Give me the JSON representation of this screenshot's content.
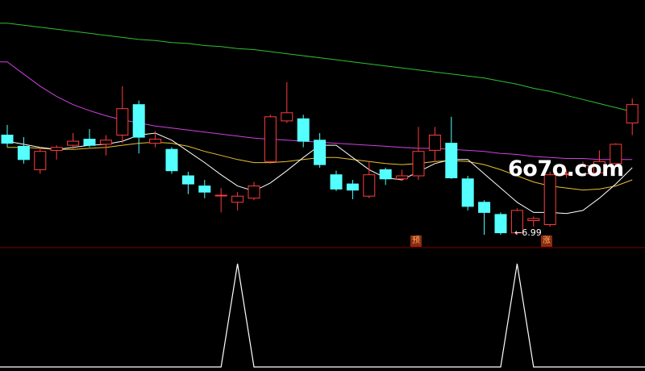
{
  "watermark": "6o7o.com",
  "low_label": "←6.99",
  "markers": {
    "pre": "预",
    "rise": "涨"
  },
  "colors": {
    "background": "#000000",
    "up": "#ff3c3c",
    "down": "#54ffff",
    "ma_short": "#ffffff",
    "ma_mid": "#e8c030",
    "ma_long": "#d040e0",
    "ma_longest": "#30c030",
    "divider": "#800000",
    "signal": "#ffffff"
  },
  "chart_data": [
    {
      "type": "candlestick",
      "series_name": "price",
      "candles": [
        {
          "o": 7.82,
          "c": 7.74,
          "h": 7.92,
          "l": 7.7
        },
        {
          "o": 7.71,
          "c": 7.58,
          "h": 7.8,
          "l": 7.54
        },
        {
          "o": 7.48,
          "c": 7.66,
          "h": 7.7,
          "l": 7.44
        },
        {
          "o": 7.67,
          "c": 7.7,
          "h": 7.72,
          "l": 7.58
        },
        {
          "o": 7.72,
          "c": 7.76,
          "h": 7.84,
          "l": 7.68
        },
        {
          "o": 7.78,
          "c": 7.72,
          "h": 7.88,
          "l": 7.7
        },
        {
          "o": 7.73,
          "c": 7.77,
          "h": 7.82,
          "l": 7.62
        },
        {
          "o": 7.82,
          "c": 8.08,
          "h": 8.3,
          "l": 7.74
        },
        {
          "o": 8.12,
          "c": 7.8,
          "h": 8.16,
          "l": 7.64
        },
        {
          "o": 7.74,
          "c": 7.78,
          "h": 7.86,
          "l": 7.7
        },
        {
          "o": 7.68,
          "c": 7.47,
          "h": 7.7,
          "l": 7.44
        },
        {
          "o": 7.42,
          "c": 7.34,
          "h": 7.46,
          "l": 7.24
        },
        {
          "o": 7.32,
          "c": 7.26,
          "h": 7.38,
          "l": 7.2
        },
        {
          "o": 7.23,
          "c": 7.23,
          "h": 7.3,
          "l": 7.06
        },
        {
          "o": 7.16,
          "c": 7.22,
          "h": 7.26,
          "l": 7.08
        },
        {
          "o": 7.2,
          "c": 7.32,
          "h": 7.36,
          "l": 7.18
        },
        {
          "o": 7.56,
          "c": 8.0,
          "h": 8.02,
          "l": 7.54
        },
        {
          "o": 7.96,
          "c": 8.04,
          "h": 8.34,
          "l": 7.94
        },
        {
          "o": 7.98,
          "c": 7.76,
          "h": 8.02,
          "l": 7.7
        },
        {
          "o": 7.77,
          "c": 7.53,
          "h": 7.84,
          "l": 7.5
        },
        {
          "o": 7.43,
          "c": 7.29,
          "h": 7.47,
          "l": 7.27
        },
        {
          "o": 7.34,
          "c": 7.28,
          "h": 7.38,
          "l": 7.19
        },
        {
          "o": 7.22,
          "c": 7.43,
          "h": 7.56,
          "l": 7.2
        },
        {
          "o": 7.48,
          "c": 7.39,
          "h": 7.5,
          "l": 7.33
        },
        {
          "o": 7.39,
          "c": 7.42,
          "h": 7.48,
          "l": 7.37
        },
        {
          "o": 7.42,
          "c": 7.66,
          "h": 7.9,
          "l": 7.38
        },
        {
          "o": 7.67,
          "c": 7.82,
          "h": 7.9,
          "l": 7.56
        },
        {
          "o": 7.74,
          "c": 7.4,
          "h": 8.0,
          "l": 7.39
        },
        {
          "o": 7.39,
          "c": 7.12,
          "h": 7.42,
          "l": 7.08
        },
        {
          "o": 7.16,
          "c": 7.06,
          "h": 7.18,
          "l": 6.84
        },
        {
          "o": 7.04,
          "c": 6.86,
          "h": 7.06,
          "l": 6.84
        },
        {
          "o": 6.86,
          "c": 7.08,
          "h": 7.1,
          "l": 6.84
        },
        {
          "o": 6.98,
          "c": 7.0,
          "h": 7.02,
          "l": 6.92
        },
        {
          "o": 6.94,
          "c": 7.43,
          "h": 7.46,
          "l": 6.92
        },
        {
          "o": 7.44,
          "c": 7.44,
          "h": 7.48,
          "l": 7.4
        },
        {
          "o": 7.44,
          "c": 7.52,
          "h": 7.56,
          "l": 7.42
        },
        {
          "o": 7.45,
          "c": 7.56,
          "h": 7.67,
          "l": 7.44
        },
        {
          "o": 7.54,
          "c": 7.73,
          "h": 7.74,
          "l": 7.52
        },
        {
          "o": 7.94,
          "c": 8.12,
          "h": 8.18,
          "l": 7.82
        }
      ],
      "ma_short": [
        7.76,
        7.73,
        7.7,
        7.68,
        7.7,
        7.72,
        7.73,
        7.76,
        7.82,
        7.84,
        7.77,
        7.66,
        7.55,
        7.43,
        7.32,
        7.27,
        7.35,
        7.47,
        7.6,
        7.72,
        7.72,
        7.6,
        7.48,
        7.4,
        7.38,
        7.46,
        7.54,
        7.58,
        7.58,
        7.44,
        7.3,
        7.16,
        7.06,
        7.06,
        7.05,
        7.08,
        7.2,
        7.34,
        7.5
      ],
      "ma_mid": [
        7.7,
        7.7,
        7.69,
        7.68,
        7.68,
        7.69,
        7.7,
        7.72,
        7.74,
        7.75,
        7.74,
        7.71,
        7.66,
        7.62,
        7.58,
        7.55,
        7.55,
        7.56,
        7.58,
        7.6,
        7.6,
        7.58,
        7.56,
        7.54,
        7.53,
        7.54,
        7.56,
        7.57,
        7.56,
        7.53,
        7.48,
        7.42,
        7.36,
        7.32,
        7.3,
        7.28,
        7.29,
        7.32,
        7.38
      ],
      "ma_long": [
        8.54,
        8.42,
        8.3,
        8.2,
        8.12,
        8.06,
        8.01,
        7.97,
        7.94,
        7.91,
        7.89,
        7.87,
        7.85,
        7.83,
        7.81,
        7.79,
        7.78,
        7.77,
        7.76,
        7.75,
        7.74,
        7.73,
        7.72,
        7.71,
        7.7,
        7.69,
        7.69,
        7.68,
        7.67,
        7.66,
        7.64,
        7.63,
        7.61,
        7.6,
        7.59,
        7.59,
        7.58,
        7.58,
        7.58
      ],
      "ma_longest": [
        8.92,
        8.9,
        8.88,
        8.86,
        8.84,
        8.82,
        8.8,
        8.78,
        8.76,
        8.75,
        8.73,
        8.72,
        8.7,
        8.69,
        8.67,
        8.66,
        8.64,
        8.62,
        8.6,
        8.58,
        8.56,
        8.54,
        8.52,
        8.5,
        8.48,
        8.46,
        8.44,
        8.42,
        8.4,
        8.38,
        8.35,
        8.32,
        8.28,
        8.25,
        8.21,
        8.17,
        8.13,
        8.09,
        8.05
      ],
      "ylim": [
        6.77,
        9.1
      ]
    },
    {
      "type": "line",
      "series_name": "signal",
      "values": [
        0,
        0,
        0,
        0,
        0,
        0,
        0,
        0,
        0,
        0,
        0,
        0,
        0,
        0,
        1,
        0,
        0,
        0,
        0,
        0,
        0,
        0,
        0,
        0,
        0,
        0,
        0,
        0,
        0,
        0,
        0,
        1,
        0,
        0,
        0,
        0,
        0,
        0,
        0
      ],
      "ylim": [
        0,
        1
      ]
    }
  ]
}
